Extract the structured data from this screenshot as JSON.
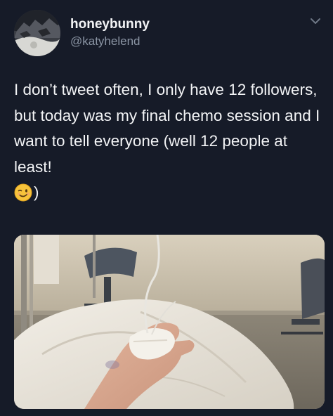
{
  "tweet": {
    "display_name": "honeybunny",
    "handle": "@katyhelend",
    "text_main": "I don’t tweet often, I only have 12 followers, but today was my final chemo session and I want to tell everyone (well 12 people at least!",
    "text_after_emoji": ")",
    "emoji": "winking-face-emoji"
  },
  "icons": {
    "more": "chevron-down-icon",
    "avatar": "avatar-photo"
  },
  "colors": {
    "background": "#161b28",
    "text": "#f2f3f5",
    "handle": "#8b95a4"
  }
}
